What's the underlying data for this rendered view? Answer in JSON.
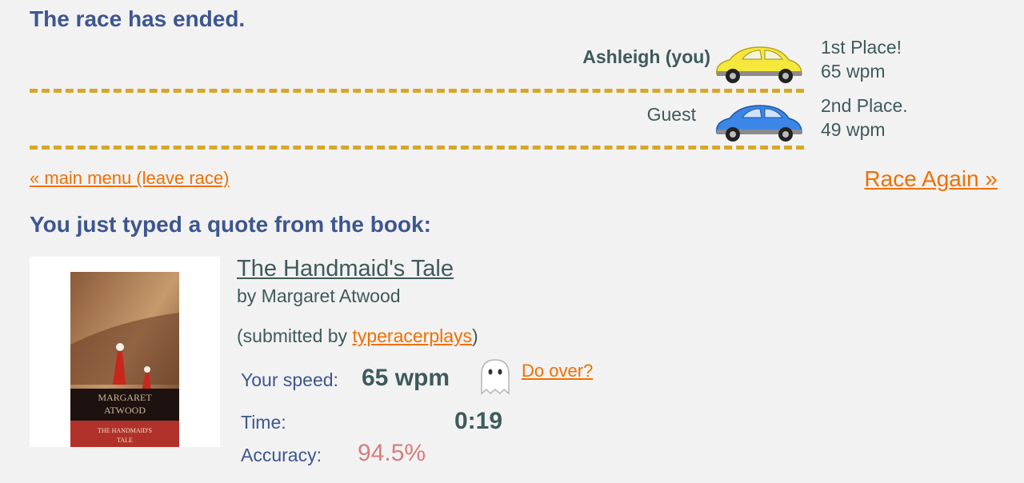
{
  "race": {
    "status_title": "The race has ended.",
    "racers": [
      {
        "name": "Ashleigh (you)",
        "place": "1st Place!",
        "wpm": "65 wpm",
        "car_color": "#f5e73b"
      },
      {
        "name": "Guest",
        "place": "2nd Place.",
        "wpm": "49 wpm",
        "car_color": "#3b86e6"
      }
    ],
    "main_menu_link": "« main menu (leave race)",
    "race_again_link": "Race Again »"
  },
  "quote": {
    "heading": "You just typed a quote from the book:",
    "book_title": "The Handmaid's Tale",
    "author": "by Margaret Atwood",
    "submitted_prefix": "(submitted by ",
    "submitted_user": "typeracerplays",
    "submitted_suffix": ")",
    "cover": {
      "author_text": "MARGARET ATWOOD",
      "title_text": "THE HANDMAID'S TALE"
    }
  },
  "results": {
    "speed_label": "Your speed:",
    "speed_value": "65 wpm",
    "do_over_link": "Do over?",
    "time_label": "Time:",
    "time_value": "0:19",
    "accuracy_label": "Accuracy:",
    "accuracy_value": "94.5%"
  }
}
